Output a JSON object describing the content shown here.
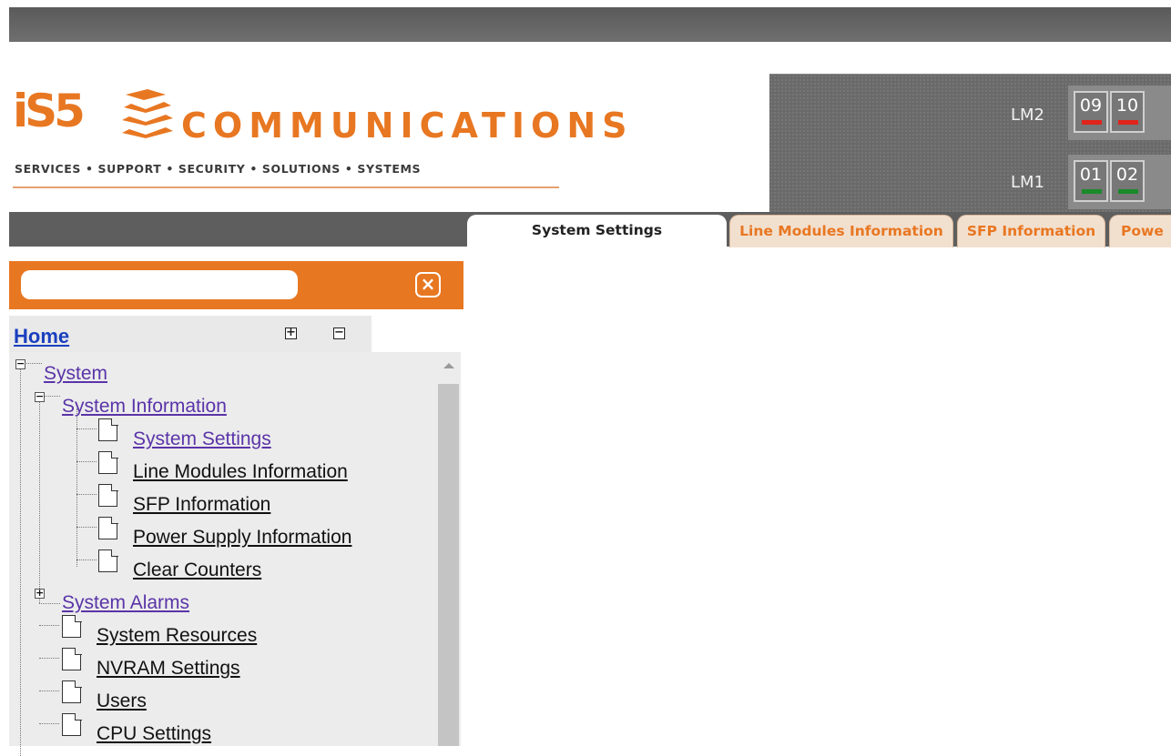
{
  "header": {
    "logo_mark": "iS5",
    "logo_word": "COMMUNICATIONS",
    "tagline": "SERVICES • SUPPORT • SECURITY • SOLUTIONS • SYSTEMS",
    "brand_color": "#e87722"
  },
  "device": {
    "modules": [
      {
        "label": "LM2",
        "ports": [
          {
            "num": "09",
            "status": "red"
          },
          {
            "num": "10",
            "status": "red"
          }
        ]
      },
      {
        "label": "LM1",
        "ports": [
          {
            "num": "01",
            "status": "green"
          },
          {
            "num": "02",
            "status": "green"
          }
        ]
      }
    ],
    "status_colors": {
      "red": "#e0241b",
      "green": "#1a8a2a"
    }
  },
  "tabs": [
    {
      "label": "System Settings",
      "active": true
    },
    {
      "label": "Line Modules Information",
      "active": false
    },
    {
      "label": "SFP Information",
      "active": false
    },
    {
      "label": "Powe",
      "active": false
    }
  ],
  "search": {
    "value": "",
    "clear_icon": "close-icon"
  },
  "tree": {
    "home_label": "Home",
    "expand_all": "+",
    "collapse_all": "−",
    "nodes": {
      "system": "System",
      "system_information": "System Information",
      "system_settings": "System Settings",
      "line_modules_information": "Line Modules Information",
      "sfp_information": "SFP Information",
      "power_supply_information": "Power Supply Information",
      "clear_counters": "Clear Counters",
      "system_alarms": "System Alarms",
      "system_resources": "System Resources",
      "nvram_settings": "NVRAM Settings",
      "users": "Users",
      "cpu_settings": "CPU Settings"
    },
    "expanded_symbol": "−",
    "collapsed_symbol": "+"
  }
}
